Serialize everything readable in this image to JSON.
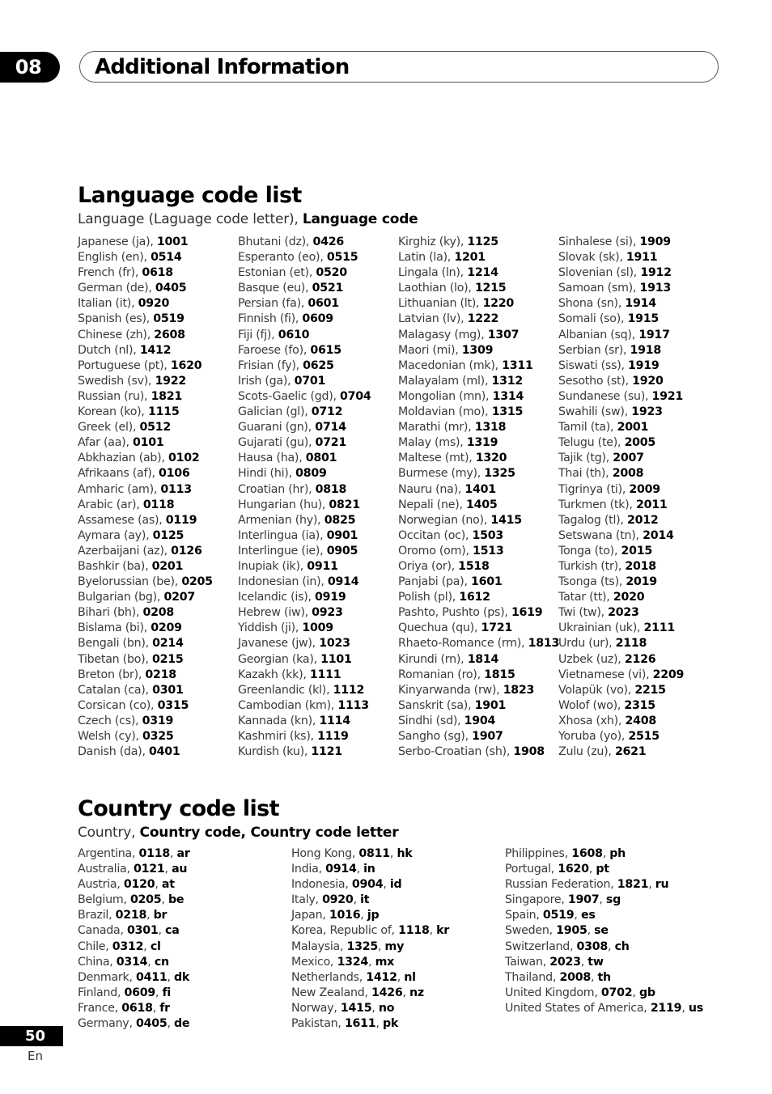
{
  "header": {
    "chapter_number": "08",
    "chapter_title": "Additional Information"
  },
  "language_section": {
    "title": "Language code list",
    "subtitle_plain": "Language (Laguage code letter), ",
    "subtitle_bold": "Language code",
    "columns": [
      [
        {
          "name": "Japanese (ja), ",
          "code": "1001"
        },
        {
          "name": "English (en), ",
          "code": "0514"
        },
        {
          "name": "French (fr), ",
          "code": "0618"
        },
        {
          "name": "German (de), ",
          "code": "0405"
        },
        {
          "name": "Italian (it), ",
          "code": "0920"
        },
        {
          "name": "Spanish (es), ",
          "code": "0519"
        },
        {
          "name": "Chinese (zh), ",
          "code": "2608"
        },
        {
          "name": "Dutch (nl), ",
          "code": "1412"
        },
        {
          "name": "Portuguese (pt), ",
          "code": "1620"
        },
        {
          "name": "Swedish (sv), ",
          "code": "1922"
        },
        {
          "name": "Russian (ru), ",
          "code": "1821"
        },
        {
          "name": "Korean (ko), ",
          "code": "1115"
        },
        {
          "name": "Greek (el), ",
          "code": "0512"
        },
        {
          "name": "Afar (aa), ",
          "code": "0101"
        },
        {
          "name": "Abkhazian (ab), ",
          "code": "0102"
        },
        {
          "name": "Afrikaans (af), ",
          "code": "0106"
        },
        {
          "name": "Amharic (am), ",
          "code": "0113"
        },
        {
          "name": "Arabic (ar), ",
          "code": "0118"
        },
        {
          "name": "Assamese (as), ",
          "code": "0119"
        },
        {
          "name": "Aymara (ay), ",
          "code": "0125"
        },
        {
          "name": "Azerbaijani (az), ",
          "code": "0126"
        },
        {
          "name": "Bashkir (ba), ",
          "code": "0201"
        },
        {
          "name": "Byelorussian (be), ",
          "code": "0205"
        },
        {
          "name": "Bulgarian (bg), ",
          "code": "0207"
        },
        {
          "name": "Bihari (bh), ",
          "code": "0208"
        },
        {
          "name": "Bislama (bi), ",
          "code": "0209"
        },
        {
          "name": "Bengali (bn), ",
          "code": "0214"
        },
        {
          "name": "Tibetan (bo), ",
          "code": "0215"
        },
        {
          "name": "Breton (br), ",
          "code": "0218"
        },
        {
          "name": "Catalan (ca), ",
          "code": "0301"
        },
        {
          "name": "Corsican (co), ",
          "code": "0315"
        },
        {
          "name": "Czech (cs), ",
          "code": "0319"
        },
        {
          "name": "Welsh (cy), ",
          "code": "0325"
        },
        {
          "name": "Danish (da), ",
          "code": "0401"
        }
      ],
      [
        {
          "name": "Bhutani (dz), ",
          "code": "0426"
        },
        {
          "name": "Esperanto (eo), ",
          "code": "0515"
        },
        {
          "name": "Estonian (et), ",
          "code": "0520"
        },
        {
          "name": "Basque (eu), ",
          "code": "0521"
        },
        {
          "name": "Persian (fa), ",
          "code": "0601"
        },
        {
          "name": "Finnish (fi), ",
          "code": "0609"
        },
        {
          "name": "Fiji (fj), ",
          "code": "0610"
        },
        {
          "name": "Faroese (fo), ",
          "code": "0615"
        },
        {
          "name": "Frisian (fy), ",
          "code": "0625"
        },
        {
          "name": "Irish (ga), ",
          "code": "0701"
        },
        {
          "name": "Scots-Gaelic (gd), ",
          "code": "0704"
        },
        {
          "name": "Galician (gl), ",
          "code": "0712"
        },
        {
          "name": "Guarani (gn), ",
          "code": "0714"
        },
        {
          "name": "Gujarati (gu), ",
          "code": "0721"
        },
        {
          "name": "Hausa (ha), ",
          "code": "0801"
        },
        {
          "name": "Hindi (hi), ",
          "code": "0809"
        },
        {
          "name": "Croatian (hr), ",
          "code": "0818"
        },
        {
          "name": "Hungarian (hu), ",
          "code": "0821"
        },
        {
          "name": "Armenian (hy), ",
          "code": "0825"
        },
        {
          "name": "Interlingua (ia), ",
          "code": "0901"
        },
        {
          "name": "Interlingue (ie), ",
          "code": "0905"
        },
        {
          "name": "Inupiak (ik), ",
          "code": "0911"
        },
        {
          "name": "Indonesian (in), ",
          "code": "0914"
        },
        {
          "name": "Icelandic (is), ",
          "code": "0919"
        },
        {
          "name": "Hebrew (iw), ",
          "code": "0923"
        },
        {
          "name": "Yiddish (ji), ",
          "code": "1009"
        },
        {
          "name": "Javanese (jw), ",
          "code": "1023"
        },
        {
          "name": "Georgian (ka), ",
          "code": "1101"
        },
        {
          "name": "Kazakh (kk), ",
          "code": "1111"
        },
        {
          "name": "Greenlandic  (kl), ",
          "code": "1112"
        },
        {
          "name": "Cambodian (km), ",
          "code": "1113"
        },
        {
          "name": "Kannada (kn), ",
          "code": "1114"
        },
        {
          "name": "Kashmiri (ks), ",
          "code": "1119"
        },
        {
          "name": "Kurdish (ku), ",
          "code": "1121"
        }
      ],
      [
        {
          "name": "Kirghiz (ky), ",
          "code": "1125"
        },
        {
          "name": "Latin (la), ",
          "code": "1201"
        },
        {
          "name": "Lingala (ln), ",
          "code": "1214"
        },
        {
          "name": "Laothian (lo), ",
          "code": "1215"
        },
        {
          "name": "Lithuanian (lt), ",
          "code": "1220"
        },
        {
          "name": "Latvian (lv), ",
          "code": "1222"
        },
        {
          "name": "Malagasy (mg), ",
          "code": "1307"
        },
        {
          "name": "Maori (mi), ",
          "code": "1309"
        },
        {
          "name": "Macedonian (mk), ",
          "code": "1311"
        },
        {
          "name": "Malayalam  (ml), ",
          "code": "1312"
        },
        {
          "name": "Mongolian (mn), ",
          "code": "1314"
        },
        {
          "name": "Moldavian (mo), ",
          "code": "1315"
        },
        {
          "name": "Marathi (mr), ",
          "code": "1318"
        },
        {
          "name": "Malay  (ms), ",
          "code": "1319"
        },
        {
          "name": "Maltese (mt), ",
          "code": "1320"
        },
        {
          "name": "Burmese (my), ",
          "code": "1325"
        },
        {
          "name": "Nauru (na), ",
          "code": "1401"
        },
        {
          "name": "Nepali (ne), ",
          "code": "1405"
        },
        {
          "name": "Norwegian (no), ",
          "code": "1415"
        },
        {
          "name": "Occitan (oc), ",
          "code": "1503"
        },
        {
          "name": "Oromo (om), ",
          "code": "1513"
        },
        {
          "name": "Oriya (or), ",
          "code": "1518"
        },
        {
          "name": "Panjabi (pa), ",
          "code": "1601"
        },
        {
          "name": "Polish (pl), ",
          "code": "1612"
        },
        {
          "name": "Pashto, Pushto (ps), ",
          "code": "1619"
        },
        {
          "name": "Quechua (qu), ",
          "code": "1721"
        },
        {
          "name": "Rhaeto-Romance (rm), ",
          "code": "1813"
        },
        {
          "name": "Kirundi (rn), ",
          "code": "1814"
        },
        {
          "name": "Romanian (ro), ",
          "code": "1815"
        },
        {
          "name": "Kinyarwanda (rw), ",
          "code": "1823"
        },
        {
          "name": "Sanskrit (sa), ",
          "code": "1901"
        },
        {
          "name": "Sindhi (sd), ",
          "code": "1904"
        },
        {
          "name": "Sangho (sg), ",
          "code": "1907"
        },
        {
          "name": "Serbo-Croatian (sh), ",
          "code": "1908"
        }
      ],
      [
        {
          "name": "Sinhalese (si), ",
          "code": "1909"
        },
        {
          "name": "Slovak (sk), ",
          "code": "1911"
        },
        {
          "name": "Slovenian (sl), ",
          "code": "1912"
        },
        {
          "name": "Samoan (sm), ",
          "code": "1913"
        },
        {
          "name": "Shona (sn), ",
          "code": "1914"
        },
        {
          "name": "Somali (so), ",
          "code": "1915"
        },
        {
          "name": "Albanian (sq), ",
          "code": "1917"
        },
        {
          "name": "Serbian (sr), ",
          "code": "1918"
        },
        {
          "name": "Siswati (ss), ",
          "code": "1919"
        },
        {
          "name": "Sesotho (st), ",
          "code": "1920"
        },
        {
          "name": "Sundanese (su), ",
          "code": "1921"
        },
        {
          "name": "Swahili (sw), ",
          "code": "1923"
        },
        {
          "name": "Tamil (ta), ",
          "code": "2001"
        },
        {
          "name": "Telugu (te), ",
          "code": "2005"
        },
        {
          "name": "Tajik (tg), ",
          "code": "2007"
        },
        {
          "name": "Thai (th), ",
          "code": "2008"
        },
        {
          "name": "Tigrinya (ti), ",
          "code": "2009"
        },
        {
          "name": "Turkmen (tk), ",
          "code": "2011"
        },
        {
          "name": "Tagalog (tl), ",
          "code": "2012"
        },
        {
          "name": "Setswana (tn), ",
          "code": "2014"
        },
        {
          "name": "Tonga (to), ",
          "code": "2015"
        },
        {
          "name": "Turkish (tr), ",
          "code": "2018"
        },
        {
          "name": "Tsonga (ts), ",
          "code": "2019"
        },
        {
          "name": "Tatar (tt), ",
          "code": "2020"
        },
        {
          "name": "Twi (tw), ",
          "code": "2023"
        },
        {
          "name": "Ukrainian (uk), ",
          "code": "2111"
        },
        {
          "name": "Urdu (ur), ",
          "code": "2118"
        },
        {
          "name": "Uzbek (uz), ",
          "code": "2126"
        },
        {
          "name": "Vietnamese (vi), ",
          "code": "2209"
        },
        {
          "name": "Volapük (vo), ",
          "code": "2215"
        },
        {
          "name": "Wolof (wo), ",
          "code": "2315"
        },
        {
          "name": "Xhosa (xh), ",
          "code": "2408"
        },
        {
          "name": "Yoruba (yo), ",
          "code": "2515"
        },
        {
          "name": "Zulu (zu), ",
          "code": "2621"
        }
      ]
    ]
  },
  "country_section": {
    "title": "Country code list",
    "subtitle_plain": "Country, ",
    "subtitle_bold": "Country code, Country code letter",
    "columns": [
      [
        {
          "name": "Argentina, ",
          "code": "0118",
          "letter": "ar"
        },
        {
          "name": "Australia, ",
          "code": "0121",
          "letter": "au"
        },
        {
          "name": "Austria, ",
          "code": "0120",
          "letter": "at"
        },
        {
          "name": "Belgium, ",
          "code": "0205",
          "letter": "be"
        },
        {
          "name": "Brazil, ",
          "code": "0218",
          "letter": "br"
        },
        {
          "name": "Canada, ",
          "code": "0301",
          "letter": "ca"
        },
        {
          "name": "Chile, ",
          "code": "0312",
          "letter": "cl"
        },
        {
          "name": "China, ",
          "code": "0314",
          "letter": "cn"
        },
        {
          "name": "Denmark, ",
          "code": "0411",
          "letter": "dk"
        },
        {
          "name": "Finland, ",
          "code": "0609",
          "letter": "fi"
        },
        {
          "name": "France, ",
          "code": "0618",
          "letter": "fr"
        },
        {
          "name": "Germany, ",
          "code": "0405",
          "letter": "de"
        }
      ],
      [
        {
          "name": "Hong Kong, ",
          "code": "0811",
          "letter": "hk"
        },
        {
          "name": "India, ",
          "code": "0914",
          "letter": "in"
        },
        {
          "name": "Indonesia, ",
          "code": "0904",
          "letter": "id"
        },
        {
          "name": "Italy, ",
          "code": "0920",
          "letter": "it"
        },
        {
          "name": "Japan, ",
          "code": "1016",
          "letter": "jp"
        },
        {
          "name": "Korea, Republic of, ",
          "code": "1118",
          "letter": "kr"
        },
        {
          "name": "Malaysia, ",
          "code": "1325",
          "letter": "my"
        },
        {
          "name": "Mexico, ",
          "code": "1324",
          "letter": "mx"
        },
        {
          "name": "Netherlands, ",
          "code": "1412",
          "letter": "nl"
        },
        {
          "name": "New Zealand, ",
          "code": "1426",
          "letter": "nz"
        },
        {
          "name": "Norway, ",
          "code": "1415",
          "letter": "no"
        },
        {
          "name": "Pakistan, ",
          "code": "1611",
          "letter": "pk"
        }
      ],
      [
        {
          "name": "Philippines, ",
          "code": "1608",
          "letter": "ph"
        },
        {
          "name": "Portugal, ",
          "code": "1620",
          "letter": "pt"
        },
        {
          "name": "Russian Federation, ",
          "code": "1821",
          "letter": "ru"
        },
        {
          "name": "Singapore, ",
          "code": "1907",
          "letter": "sg"
        },
        {
          "name": "Spain, ",
          "code": "0519",
          "letter": "es"
        },
        {
          "name": "Sweden, ",
          "code": "1905",
          "letter": "se"
        },
        {
          "name": "Switzerland, ",
          "code": "0308",
          "letter": "ch"
        },
        {
          "name": "Taiwan, ",
          "code": "2023",
          "letter": "tw"
        },
        {
          "name": "Thailand, ",
          "code": "2008",
          "letter": "th"
        },
        {
          "name": "United Kingdom, ",
          "code": "0702",
          "letter": "gb"
        },
        {
          "name": "United States of America, ",
          "code": "2119",
          "letter": "us"
        }
      ]
    ]
  },
  "footer": {
    "page_number": "50",
    "language": "En"
  }
}
